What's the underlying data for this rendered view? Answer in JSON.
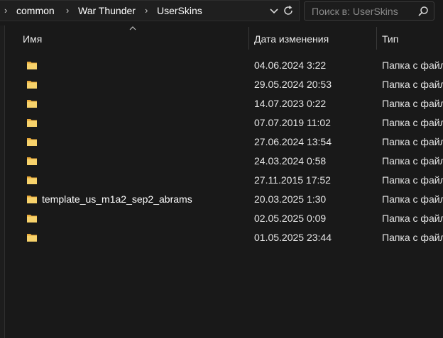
{
  "breadcrumb": {
    "items": [
      "common",
      "War Thunder",
      "UserSkins"
    ]
  },
  "search": {
    "placeholder": "Поиск в: UserSkins"
  },
  "columns": {
    "name": "Имя",
    "date": "Дата изменения",
    "type": "Тип"
  },
  "rows": [
    {
      "name": "",
      "date": "04.06.2024 3:22",
      "type": "Папка с файлами"
    },
    {
      "name": "",
      "date": "29.05.2024 20:53",
      "type": "Папка с файлами"
    },
    {
      "name": "",
      "date": "14.07.2023 0:22",
      "type": "Папка с файлами"
    },
    {
      "name": "",
      "date": "07.07.2019 11:02",
      "type": "Папка с файлами"
    },
    {
      "name": "",
      "date": "27.06.2024 13:54",
      "type": "Папка с файлами"
    },
    {
      "name": "",
      "date": "24.03.2024 0:58",
      "type": "Папка с файлами"
    },
    {
      "name": "",
      "date": "27.11.2015 17:52",
      "type": "Папка с файлами"
    },
    {
      "name": "template_us_m1a2_sep2_abrams",
      "date": "20.03.2025 1:30",
      "type": "Папка с файлами"
    },
    {
      "name": "",
      "date": "02.05.2025 0:09",
      "type": "Папка с файлами"
    },
    {
      "name": "",
      "date": "01.05.2025 23:44",
      "type": "Папка с файлами"
    }
  ],
  "icons": {
    "folder": "folder-icon",
    "search": "search-icon",
    "refresh": "refresh-icon",
    "dropdown": "chevron-down-icon",
    "crumb_sep": "chevron-right-icon"
  },
  "colors": {
    "background": "#191919",
    "folder": "#f2c14e"
  }
}
